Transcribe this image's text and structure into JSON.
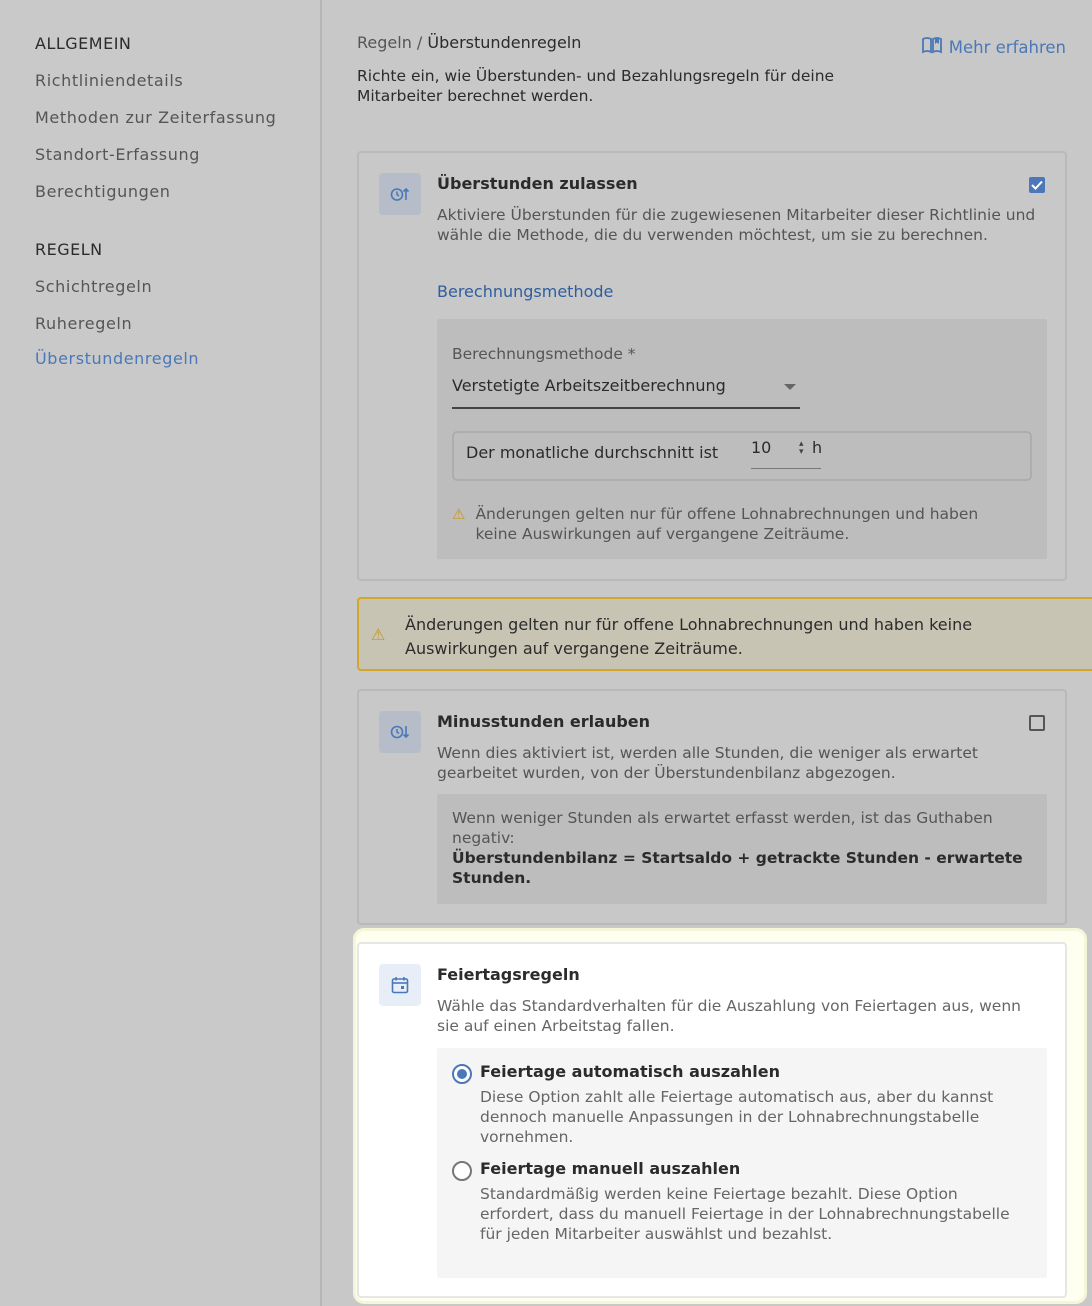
{
  "sidebar": {
    "section_general": "ALLGEMEIN",
    "general_items": [
      "Richtliniendetails",
      "Methoden zur Zeiterfassung",
      "Standort-Erfassung",
      "Berechtigungen"
    ],
    "section_rules": "REGELN",
    "rules_items": [
      "Schichtregeln",
      "Ruheregeln",
      "Überstundenregeln"
    ],
    "active_item": "Überstundenregeln"
  },
  "header": {
    "breadcrumb_parent": "Regeln",
    "breadcrumb_sep": " / ",
    "breadcrumb_current": "Überstundenregeln",
    "learn_more": "Mehr erfahren",
    "subtitle": "Richte ein, wie Überstunden- und Bezahlungsregeln für deine Mitarbeiter berechnet werden."
  },
  "overtime": {
    "title": "Überstunden zulassen",
    "description": "Aktiviere Überstunden für die zugewiesenen Mitarbeiter dieser Richtlinie und wähle die Methode, die du verwenden möchtest, um sie zu berechnen.",
    "checked": true,
    "section_link": "Berechnungsmethode",
    "method_label": "Berechnungsmethode *",
    "method_value": "Verstetigte Arbeitszeitberechnung",
    "average_label": "Der monatliche durchschnitt ist",
    "average_value": "10",
    "average_unit": "h",
    "warning": "Änderungen gelten nur für offene Lohnabrechnungen und haben keine Auswirkungen auf vergangene Zeiträume."
  },
  "banner": {
    "text": "Änderungen gelten nur für offene Lohnabrechnungen und haben keine Auswirkungen auf vergangene Zeiträume."
  },
  "minus": {
    "title": "Minusstunden erlauben",
    "description": "Wenn dies aktiviert ist, werden alle Stunden, die weniger als erwartet gearbeitet wurden, von der Überstundenbilanz abgezogen.",
    "checked": false,
    "info_text": "Wenn weniger Stunden als erwartet erfasst werden, ist das Guthaben negativ:",
    "info_formula": "Überstundenbilanz = Startsaldo + getrackte Stunden - erwartete Stunden."
  },
  "holiday": {
    "title": "Feiertagsregeln",
    "description": "Wähle das Standardverhalten für die Auszahlung von Feiertagen aus, wenn sie auf einen Arbeitstag fallen.",
    "options": [
      {
        "title": "Feiertage automatisch auszahlen",
        "description": "Diese Option zahlt alle Feiertage automatisch aus, aber du kannst dennoch manuelle Anpassungen in der Lohnabrechnungstabelle vornehmen.",
        "selected": true
      },
      {
        "title": "Feiertage manuell auszahlen",
        "description": "Standardmäßig werden keine Feiertage bezahlt. Diese Option erfordert, dass du manuell Feiertage in der Lohnabrechnungstabelle für jeden Mitarbeiter auswählst und bezahlst.",
        "selected": false
      }
    ]
  },
  "icons": {
    "overtime": "clock-up-icon",
    "minus": "clock-down-icon",
    "holiday": "calendar-icon",
    "learn": "book-icon",
    "warning": "warning-icon"
  },
  "colors": {
    "accent": "#4a78b8",
    "warning": "#d3a529"
  }
}
